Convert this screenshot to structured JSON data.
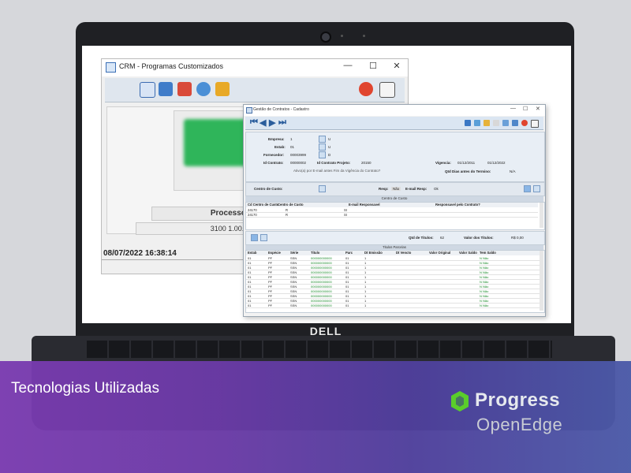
{
  "laptop": {
    "brand": "DELL"
  },
  "crm_window": {
    "title": "CRM - Programas Customizados",
    "controls": {
      "minimize": "—",
      "maximize": "☐",
      "close": "✕"
    },
    "processos_label": "Processos Cus",
    "code_text": "3100 1.00.00",
    "datetime": "08/07/2022 16:38:14"
  },
  "gc_window": {
    "title": "Gestão de Contratos - Cadastro",
    "fields": {
      "empresa_label": "Empresa:",
      "empresa_value": "1",
      "empresa_tag": "U",
      "estab_label": "Estab:",
      "estab_value": "01",
      "estab_tag": "U",
      "fornecedor_label": "Fornecedor:",
      "fornecedor_value": "00003999",
      "fornecedor_tag": "D",
      "id_contrato_label": "Id Contrato:",
      "id_contrato_value": "00000002",
      "id_projeto_label": "Id Contrato Projeto:",
      "id_projeto_value": "20150",
      "vigencia_label": "Vigencia:",
      "vigencia_start": "01/12/2011",
      "vigencia_end": "01/12/2022",
      "qtd_dias_label": "Qtd Dias antes do Termino:",
      "qtd_dias_value": "N/A",
      "ativo_text": "Ativo(a) por E-mail antes Fim da Vigência do Contrato?"
    },
    "cc_bar": {
      "centro_label": "Centro de Custo:",
      "resp_label": "Resp:",
      "resp_value": "Não",
      "email_label": "E-mail Resp:",
      "email_value": "Ok"
    },
    "cc_section_title": "Centro de Custo",
    "cc_columns": [
      "Cd Centro de Custo",
      "Centro de Custo",
      "E-mail Responsavel",
      "Responsavel pelo Contrato?"
    ],
    "cc_rows": [
      [
        "24170",
        "R",
        "SI",
        ""
      ],
      [
        "24170",
        "R",
        "SI",
        ""
      ]
    ],
    "titles_bar": {
      "qtd_label": "Qtd de Titulos:",
      "qtd_value": "62",
      "valor_label": "Valor dos Titulos:",
      "valor_value": "R$ 0,00"
    },
    "tp_section_title": "Titulos Parcelas",
    "tp_columns": [
      "Estab",
      "Espécie",
      "Série",
      "Titulo",
      "Parc",
      "Dt Emissão",
      "Dt Vencto",
      "Valor Original",
      "Valor Saldo",
      "Tem Saldo"
    ],
    "tp_rows": [
      [
        "01",
        "PF",
        "SSN",
        "000000000000",
        "01",
        "1",
        "",
        "",
        "",
        "N Não"
      ],
      [
        "01",
        "PF",
        "SSN",
        "000000000000",
        "01",
        "1",
        "",
        "",
        "",
        "N Não"
      ],
      [
        "01",
        "PF",
        "SSN",
        "000000000000",
        "01",
        "1",
        "",
        "",
        "",
        "N Não"
      ],
      [
        "01",
        "PF",
        "SSN",
        "000000000000",
        "01",
        "1",
        "",
        "",
        "",
        "N Não"
      ],
      [
        "01",
        "PF",
        "SSN",
        "000000000000",
        "01",
        "1",
        "",
        "",
        "",
        "N Não"
      ],
      [
        "01",
        "PF",
        "SSN",
        "000000000000",
        "01",
        "1",
        "",
        "",
        "",
        "N Não"
      ],
      [
        "01",
        "PF",
        "SSN",
        "000000000000",
        "01",
        "1",
        "",
        "",
        "",
        "N Não"
      ],
      [
        "01",
        "PF",
        "SSN",
        "000000000000",
        "01",
        "1",
        "",
        "",
        "",
        "N Não"
      ],
      [
        "01",
        "PF",
        "SSN",
        "000000000000",
        "01",
        "1",
        "",
        "",
        "",
        "N Não"
      ],
      [
        "01",
        "PF",
        "SSN",
        "000000000000",
        "01",
        "1",
        "",
        "",
        "",
        "N Não"
      ],
      [
        "01",
        "PF",
        "SSN",
        "000000000000",
        "01",
        "1",
        "",
        "",
        "",
        "N Não"
      ]
    ]
  },
  "banner": {
    "heading": "Tecnologias Utilizadas",
    "logo_line1": "Progress",
    "logo_line2": "OpenEdge"
  },
  "colors": {
    "banner_left": "#7a3bb0",
    "banner_right": "#4b5aa8",
    "accent_green": "#2fb55a",
    "progress_green": "#5ace2b"
  }
}
